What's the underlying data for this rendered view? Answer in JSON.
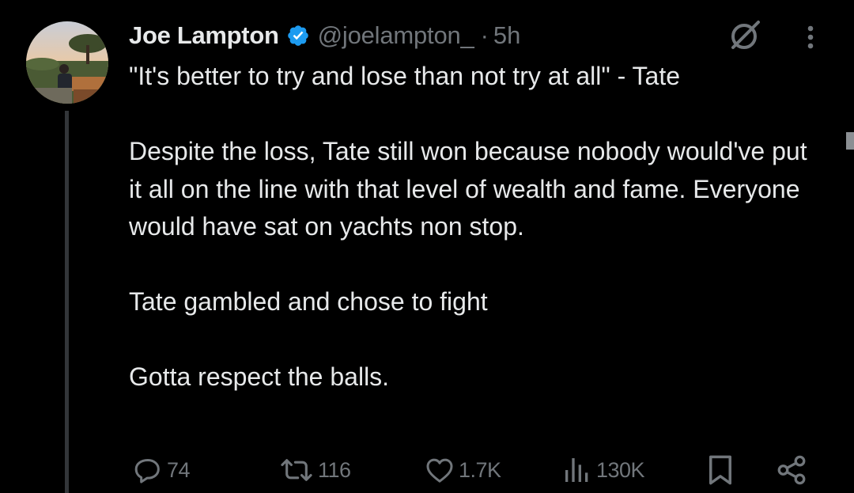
{
  "author": {
    "name": "Joe Lampton",
    "handle": "@joelampton_",
    "separator": "·",
    "time": "5h",
    "verified_icon": "verified-badge-icon",
    "avatar": "avatar-photo"
  },
  "tweet": {
    "paragraphs": [
      "\"It's better to try and lose than not try at all\" - Tate",
      "",
      "Despite the loss, Tate still won because nobody would've put it all on the line with that level of wealth and fame. Everyone would have sat on yachts non stop.",
      "",
      "Tate gambled and chose to fight",
      "",
      "Gotta respect the balls."
    ]
  },
  "actions": {
    "reply": {
      "icon": "reply-icon",
      "count": "74"
    },
    "retweet": {
      "icon": "retweet-icon",
      "count": "116"
    },
    "like": {
      "icon": "heart-icon",
      "count": "1.7K"
    },
    "views": {
      "icon": "views-icon",
      "count": "130K"
    },
    "bookmark": {
      "icon": "bookmark-icon"
    },
    "share": {
      "icon": "share-icon"
    }
  },
  "header_icons": {
    "grok": "grok-icon",
    "more": "more-icon"
  },
  "colors": {
    "background": "#000000",
    "text": "#e7e9ea",
    "muted": "#71767b",
    "verified": "#1d9bf0",
    "thread_line": "#333639"
  }
}
